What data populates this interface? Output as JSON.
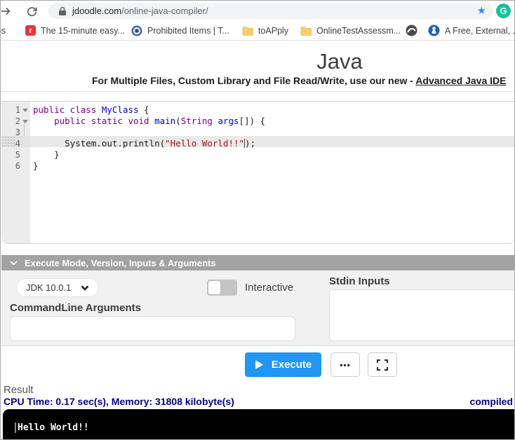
{
  "browser": {
    "url_domain": "jdoodle.com",
    "url_path": "/online-java-compiler/",
    "star_glyph": "★",
    "grammarly_glyph": "G",
    "reddit_glyph": "r"
  },
  "bookmarks": {
    "clipped_left": "ps",
    "item1": "The 15-minute easy...",
    "item2": "Prohibited Items | T...",
    "item3": "toAPply",
    "item4": "OnlineTestAssessm...",
    "item5": "A Free, External, .N"
  },
  "header": {
    "title": "Java",
    "subtitle_prefix": "For Multiple Files, Custom Library and File Read/Write, use our new - ",
    "subtitle_link": "Advanced Java IDE"
  },
  "editor": {
    "gutter": {
      "n1": "1",
      "n2": "2",
      "n3": "3",
      "n4": "4",
      "n5": "5",
      "n6": "6"
    },
    "line1": {
      "kw": "public class",
      "sp": " ",
      "def": "MyClass",
      "rest": " {"
    },
    "line2": {
      "indent": "    ",
      "kw": "public static void",
      "sp": " ",
      "def": "main",
      "paren": "(",
      "type": "String",
      "sp2": " ",
      "def2": "args",
      "rest": "[]) {"
    },
    "line3": {
      "text": ""
    },
    "line4": {
      "pre": "      System.out.println(",
      "str": "\"Hello World!!\"",
      "post": ");"
    },
    "line5": {
      "text": "    }"
    },
    "line6": {
      "text": "}"
    }
  },
  "controls": {
    "section_title": "Execute Mode, Version, Inputs & Arguments",
    "jdk_value": "JDK 10.0.1",
    "interactive_label": "Interactive",
    "stdin_label": "Stdin Inputs",
    "cmdline_label": "CommandLine Arguments",
    "execute_label": "Execute",
    "more_glyph": "•••"
  },
  "result": {
    "title": "Result",
    "stats": "CPU Time: 0.17 sec(s), Memory: 31808 kilobyte(s)",
    "status": "compiled",
    "output": "Hello World!!"
  },
  "colors": {
    "execute_blue": "#2196f3",
    "result_navy": "#00008b",
    "keyword_purple": "#770088",
    "string_red": "#aa1111",
    "section_bar_gray": "#a2a2a2",
    "grammarly_green": "#15c39a"
  }
}
